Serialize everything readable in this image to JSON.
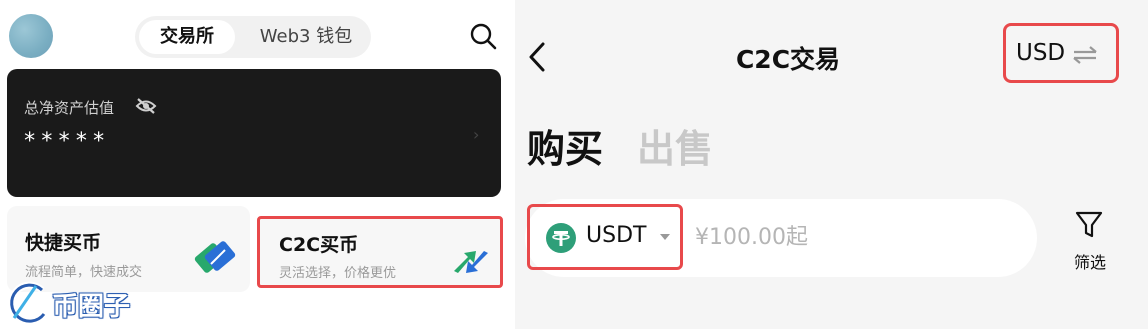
{
  "left": {
    "tabs": {
      "exchange": "交易所",
      "web3_wallet": "Web3 钱包"
    },
    "asset": {
      "label": "总净资产估值",
      "value": "*****",
      "arrow": "›"
    },
    "quick_buy": {
      "title": "快捷买币",
      "subtitle": "流程简单，快速成交"
    },
    "c2c_buy": {
      "title": "C2C买币",
      "subtitle": "灵活选择，价格更优"
    },
    "watermark": "币圈子"
  },
  "right": {
    "nav": {
      "back": "‹",
      "title": "C2C交易",
      "currency": "USD",
      "swap_icon": "⇌"
    },
    "tabs": {
      "buy": "购买",
      "sell": "出售"
    },
    "coin": {
      "symbol": "USDT"
    },
    "amount": {
      "placeholder": "¥100.00起"
    },
    "filter": {
      "label": "筛选"
    }
  },
  "colors": {
    "highlight": "#e8494b",
    "usdt_green": "#2e9f79",
    "card_dark": "#1a1a1a"
  },
  "icons": [
    "avatar",
    "search-icon",
    "eye-hidden-icon",
    "chevron-right-icon",
    "card-icon",
    "exchange-arrows-icon",
    "back-icon",
    "swap-icon",
    "usdt-icon",
    "caret-down-icon",
    "filter-icon"
  ]
}
